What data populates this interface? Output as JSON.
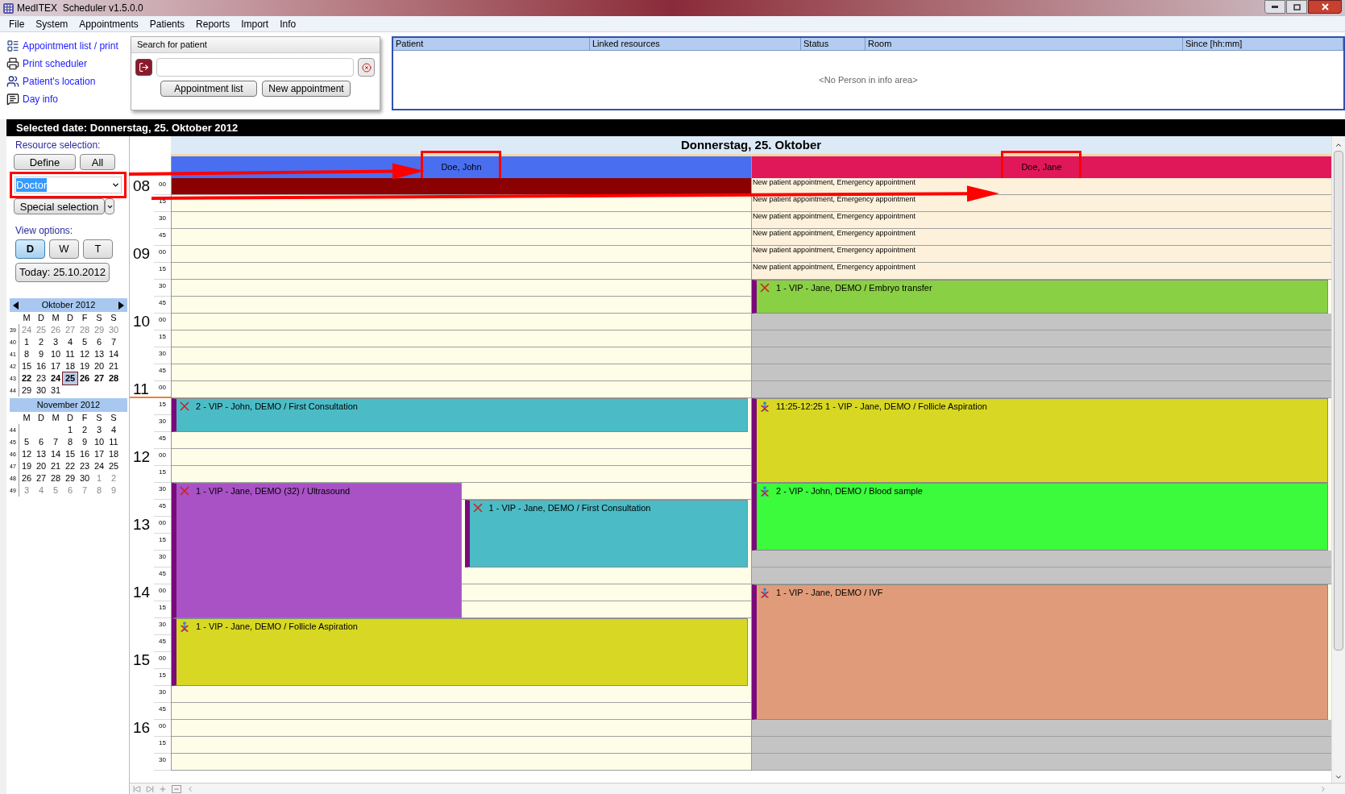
{
  "window": {
    "title": "MedITEX  Scheduler v1.5.0.0"
  },
  "menu": [
    "File",
    "System",
    "Appointments",
    "Patients",
    "Reports",
    "Import",
    "Info"
  ],
  "quick_links": [
    "Appointment list / print",
    "Print scheduler",
    "Patient's location",
    "Day info"
  ],
  "patient_search": {
    "title": "Search for patient",
    "buttons": [
      "Appointment list",
      "New appointment"
    ]
  },
  "info_area": {
    "columns": [
      "Patient",
      "Linked resources",
      "Status",
      "Room",
      "Since [hh:mm]"
    ],
    "empty_text": "<No Person in info area>"
  },
  "selected_date": "Selected date: Donnerstag, 25. Oktober 2012",
  "sidebar": {
    "resource_label": "Resource selection:",
    "resource_buttons": [
      "Define",
      "All"
    ],
    "resource_dropdown": {
      "value": "Doctor",
      "highlighted": true
    },
    "special_selection": "Special selection",
    "view_label": "View options:",
    "views": [
      {
        "label": "D",
        "selected": true
      },
      {
        "label": "W",
        "selected": false
      },
      {
        "label": "T",
        "selected": false
      }
    ],
    "today_button": "Today: 25.10.2012"
  },
  "calendars": [
    {
      "title": "Oktober 2012",
      "arrows": true,
      "weekdays": [
        "M",
        "D",
        "M",
        "D",
        "F",
        "S",
        "S"
      ],
      "weeks": [
        {
          "week": "39",
          "days": [
            {
              "d": "24",
              "outside": true,
              "bold": false,
              "selected": false
            },
            {
              "d": "25",
              "outside": true,
              "bold": false,
              "selected": false
            },
            {
              "d": "26",
              "outside": true,
              "bold": false,
              "selected": false
            },
            {
              "d": "27",
              "outside": true,
              "bold": false,
              "selected": false
            },
            {
              "d": "28",
              "outside": true,
              "bold": false,
              "selected": false
            },
            {
              "d": "29",
              "outside": true,
              "bold": false,
              "selected": false
            },
            {
              "d": "30",
              "outside": true,
              "bold": false,
              "selected": false
            }
          ]
        },
        {
          "week": "40",
          "days": [
            {
              "d": "1",
              "outside": false,
              "bold": false,
              "selected": false
            },
            {
              "d": "2",
              "outside": false,
              "bold": false,
              "selected": false
            },
            {
              "d": "3",
              "outside": false,
              "bold": false,
              "selected": false
            },
            {
              "d": "4",
              "outside": false,
              "bold": false,
              "selected": false
            },
            {
              "d": "5",
              "outside": false,
              "bold": false,
              "selected": false
            },
            {
              "d": "6",
              "outside": false,
              "bold": false,
              "selected": false
            },
            {
              "d": "7",
              "outside": false,
              "bold": false,
              "selected": false
            }
          ]
        },
        {
          "week": "41",
          "days": [
            {
              "d": "8",
              "outside": false,
              "bold": false,
              "selected": false
            },
            {
              "d": "9",
              "outside": false,
              "bold": false,
              "selected": false
            },
            {
              "d": "10",
              "outside": false,
              "bold": false,
              "selected": false
            },
            {
              "d": "11",
              "outside": false,
              "bold": false,
              "selected": false
            },
            {
              "d": "12",
              "outside": false,
              "bold": false,
              "selected": false
            },
            {
              "d": "13",
              "outside": false,
              "bold": false,
              "selected": false
            },
            {
              "d": "14",
              "outside": false,
              "bold": false,
              "selected": false
            }
          ]
        },
        {
          "week": "42",
          "days": [
            {
              "d": "15",
              "outside": false,
              "bold": false,
              "selected": false
            },
            {
              "d": "16",
              "outside": false,
              "bold": false,
              "selected": false
            },
            {
              "d": "17",
              "outside": false,
              "bold": false,
              "selected": false
            },
            {
              "d": "18",
              "outside": false,
              "bold": false,
              "selected": false
            },
            {
              "d": "19",
              "outside": false,
              "bold": false,
              "selected": false
            },
            {
              "d": "20",
              "outside": false,
              "bold": false,
              "selected": false
            },
            {
              "d": "21",
              "outside": false,
              "bold": false,
              "selected": false
            }
          ]
        },
        {
          "week": "43",
          "days": [
            {
              "d": "22",
              "outside": false,
              "bold": true,
              "selected": false
            },
            {
              "d": "23",
              "outside": false,
              "bold": false,
              "selected": false
            },
            {
              "d": "24",
              "outside": false,
              "bold": true,
              "selected": false
            },
            {
              "d": "25",
              "outside": false,
              "bold": true,
              "selected": true
            },
            {
              "d": "26",
              "outside": false,
              "bold": true,
              "selected": false
            },
            {
              "d": "27",
              "outside": false,
              "bold": true,
              "selected": false
            },
            {
              "d": "28",
              "outside": false,
              "bold": true,
              "selected": false
            }
          ]
        },
        {
          "week": "44",
          "days": [
            {
              "d": "29",
              "outside": false,
              "bold": false,
              "selected": false
            },
            {
              "d": "30",
              "outside": false,
              "bold": false,
              "selected": false
            },
            {
              "d": "31",
              "outside": false,
              "bold": false,
              "selected": false
            }
          ]
        }
      ]
    },
    {
      "title": "November 2012",
      "arrows": false,
      "weekdays": [
        "M",
        "D",
        "M",
        "D",
        "F",
        "S",
        "S"
      ],
      "weeks": [
        {
          "week": "44",
          "days": [
            {
              "d": "1",
              "outside": false,
              "bold": false,
              "selected": false
            },
            {
              "d": "2",
              "outside": false,
              "bold": false,
              "selected": false
            },
            {
              "d": "3",
              "outside": false,
              "bold": false,
              "selected": false
            },
            {
              "d": "4",
              "outside": false,
              "bold": false,
              "selected": false
            }
          ]
        },
        {
          "week": "45",
          "days": [
            {
              "d": "5",
              "outside": false,
              "bold": false,
              "selected": false
            },
            {
              "d": "6",
              "outside": false,
              "bold": false,
              "selected": false
            },
            {
              "d": "7",
              "outside": false,
              "bold": false,
              "selected": false
            },
            {
              "d": "8",
              "outside": false,
              "bold": false,
              "selected": false
            },
            {
              "d": "9",
              "outside": false,
              "bold": false,
              "selected": false
            },
            {
              "d": "10",
              "outside": false,
              "bold": false,
              "selected": false
            },
            {
              "d": "11",
              "outside": false,
              "bold": false,
              "selected": false
            }
          ]
        },
        {
          "week": "46",
          "days": [
            {
              "d": "12",
              "outside": false,
              "bold": false,
              "selected": false
            },
            {
              "d": "13",
              "outside": false,
              "bold": false,
              "selected": false
            },
            {
              "d": "14",
              "outside": false,
              "bold": false,
              "selected": false
            },
            {
              "d": "15",
              "outside": false,
              "bold": false,
              "selected": false
            },
            {
              "d": "16",
              "outside": false,
              "bold": false,
              "selected": false
            },
            {
              "d": "17",
              "outside": false,
              "bold": false,
              "selected": false
            },
            {
              "d": "18",
              "outside": false,
              "bold": false,
              "selected": false
            }
          ]
        },
        {
          "week": "47",
          "days": [
            {
              "d": "19",
              "outside": false,
              "bold": false,
              "selected": false
            },
            {
              "d": "20",
              "outside": false,
              "bold": false,
              "selected": false
            },
            {
              "d": "21",
              "outside": false,
              "bold": false,
              "selected": false
            },
            {
              "d": "22",
              "outside": false,
              "bold": false,
              "selected": false
            },
            {
              "d": "23",
              "outside": false,
              "bold": false,
              "selected": false
            },
            {
              "d": "24",
              "outside": false,
              "bold": false,
              "selected": false
            },
            {
              "d": "25",
              "outside": false,
              "bold": false,
              "selected": false
            }
          ]
        },
        {
          "week": "48",
          "days": [
            {
              "d": "26",
              "outside": false,
              "bold": false,
              "selected": false
            },
            {
              "d": "27",
              "outside": false,
              "bold": false,
              "selected": false
            },
            {
              "d": "28",
              "outside": false,
              "bold": false,
              "selected": false
            },
            {
              "d": "29",
              "outside": false,
              "bold": false,
              "selected": false
            },
            {
              "d": "30",
              "outside": false,
              "bold": false,
              "selected": false
            },
            {
              "d": "1",
              "outside": true,
              "bold": false,
              "selected": false
            },
            {
              "d": "2",
              "outside": true,
              "bold": false,
              "selected": false
            }
          ]
        },
        {
          "week": "49",
          "days": [
            {
              "d": "3",
              "outside": true,
              "bold": false,
              "selected": false
            },
            {
              "d": "4",
              "outside": true,
              "bold": false,
              "selected": false
            },
            {
              "d": "5",
              "outside": true,
              "bold": false,
              "selected": false
            },
            {
              "d": "6",
              "outside": true,
              "bold": false,
              "selected": false
            },
            {
              "d": "7",
              "outside": true,
              "bold": false,
              "selected": false
            },
            {
              "d": "8",
              "outside": true,
              "bold": false,
              "selected": false
            },
            {
              "d": "9",
              "outside": true,
              "bold": false,
              "selected": false
            }
          ]
        }
      ]
    }
  ],
  "day": {
    "title": "Donnerstag, 25. Oktober",
    "times": [
      {
        "hour": "08",
        "minute": "00"
      },
      {
        "minute": "15"
      },
      {
        "minute": "30"
      },
      {
        "minute": "45"
      },
      {
        "hour": "09",
        "minute": "00"
      },
      {
        "minute": "15"
      },
      {
        "minute": "30"
      },
      {
        "minute": "45"
      },
      {
        "hour": "10",
        "minute": "00"
      },
      {
        "minute": "15"
      },
      {
        "minute": "30"
      },
      {
        "minute": "45"
      },
      {
        "hour": "11",
        "minute": "00",
        "current": true
      },
      {
        "minute": "15"
      },
      {
        "minute": "30"
      },
      {
        "minute": "45"
      },
      {
        "hour": "12",
        "minute": "00"
      },
      {
        "minute": "15"
      },
      {
        "minute": "30"
      },
      {
        "minute": "45"
      },
      {
        "hour": "13",
        "minute": "00"
      },
      {
        "minute": "15"
      },
      {
        "minute": "30"
      },
      {
        "minute": "45"
      },
      {
        "hour": "14",
        "minute": "00"
      },
      {
        "minute": "15"
      },
      {
        "minute": "30"
      },
      {
        "minute": "45"
      },
      {
        "hour": "15",
        "minute": "00"
      },
      {
        "minute": "15"
      },
      {
        "minute": "30"
      },
      {
        "minute": "45"
      },
      {
        "hour": "16",
        "minute": "00"
      },
      {
        "minute": "15"
      },
      {
        "minute": "30"
      }
    ],
    "resources": [
      {
        "name": "Doe, John",
        "color": "#4a6ef0",
        "highlighted": true,
        "rows": [
          [
            {
              "kind": "blocked",
              "color": "#8b0000"
            }
          ],
          [
            {
              "kind": "free"
            }
          ],
          [
            {
              "kind": "free"
            }
          ],
          [
            {
              "kind": "free"
            }
          ],
          [
            {
              "kind": "free"
            }
          ],
          [
            {
              "kind": "free"
            }
          ],
          [
            {
              "kind": "free"
            }
          ],
          [
            {
              "kind": "free"
            }
          ],
          [
            {
              "kind": "free"
            }
          ],
          [
            {
              "kind": "free"
            }
          ],
          [
            {
              "kind": "free"
            }
          ],
          [
            {
              "kind": "free"
            }
          ],
          [
            {
              "kind": "free"
            }
          ],
          [
            {
              "kind": "appointment",
              "color": "#4bbcc6",
              "patient_icon": false,
              "text": "2 - VIP - John, DEMO / First Consultation"
            }
          ],
          [
            {
              "kind": "continued"
            }
          ],
          [
            {
              "kind": "free"
            }
          ],
          [
            {
              "kind": "free"
            }
          ],
          [
            {
              "kind": "free"
            }
          ],
          [
            {
              "kind": "appointment",
              "color": "#a852c6",
              "patient_icon": false,
              "text": "1 - VIP - Jane, DEMO (32) / Ultrasound"
            },
            {
              "kind": "free"
            }
          ],
          [
            {
              "kind": "continued"
            },
            {
              "kind": "appointment",
              "color": "#4bbcc6",
              "patient_icon": false,
              "text": "1 - VIP - Jane, DEMO / First Consultation"
            }
          ],
          [
            {
              "kind": "continued"
            },
            {
              "kind": "continued"
            }
          ],
          [
            {
              "kind": "continued"
            },
            {
              "kind": "continued"
            }
          ],
          [
            {
              "kind": "continued"
            },
            {
              "kind": "continued"
            }
          ],
          [
            {
              "kind": "continued"
            },
            {
              "kind": "free"
            }
          ],
          [
            {
              "kind": "continued"
            },
            {
              "kind": "free"
            }
          ],
          [
            {
              "kind": "continued"
            },
            {
              "kind": "free"
            }
          ],
          [
            {
              "kind": "appointment",
              "color": "#d8d824",
              "patient_icon": true,
              "text": "1 - VIP - Jane, DEMO / Follicle Aspiration"
            }
          ],
          [
            {
              "kind": "continued"
            }
          ],
          [
            {
              "kind": "continued"
            }
          ],
          [
            {
              "kind": "continued"
            }
          ],
          [
            {
              "kind": "free"
            }
          ],
          [
            {
              "kind": "free"
            }
          ],
          [
            {
              "kind": "free"
            }
          ],
          [
            {
              "kind": "free"
            }
          ],
          [
            {
              "kind": "free"
            }
          ]
        ]
      },
      {
        "name": "Doe, Jane",
        "color": "#e0185a",
        "highlighted": true,
        "rows": [
          [
            {
              "kind": "label",
              "text": "New patient appointment, Emergency appointment"
            }
          ],
          [
            {
              "kind": "label",
              "text": "New patient appointment, Emergency appointment"
            }
          ],
          [
            {
              "kind": "label",
              "text": "New patient appointment, Emergency appointment"
            }
          ],
          [
            {
              "kind": "label",
              "text": "New patient appointment, Emergency appointment"
            }
          ],
          [
            {
              "kind": "label",
              "text": "New patient appointment, Emergency appointment"
            }
          ],
          [
            {
              "kind": "label",
              "text": "New patient appointment, Emergency appointment"
            }
          ],
          [
            {
              "kind": "appointment",
              "color": "#8ad044",
              "patient_icon": false,
              "text": "1 - VIP - Jane, DEMO / Embryo transfer"
            }
          ],
          [
            {
              "kind": "continued"
            }
          ],
          [
            {
              "kind": "unavailable"
            }
          ],
          [
            {
              "kind": "unavailable"
            }
          ],
          [
            {
              "kind": "unavailable"
            }
          ],
          [
            {
              "kind": "unavailable"
            }
          ],
          [
            {
              "kind": "unavailable"
            }
          ],
          [
            {
              "kind": "appointment",
              "color": "#d8d824",
              "patient_icon": true,
              "text": "11:25-12:25 1 - VIP - Jane, DEMO / Follicle Aspiration"
            }
          ],
          [
            {
              "kind": "continued"
            }
          ],
          [
            {
              "kind": "continued"
            }
          ],
          [
            {
              "kind": "continued"
            }
          ],
          [
            {
              "kind": "continued"
            }
          ],
          [
            {
              "kind": "appointment",
              "color": "#3cfa3c",
              "patient_icon": true,
              "text": "2 - VIP - John, DEMO / Blood sample"
            }
          ],
          [
            {
              "kind": "continued"
            }
          ],
          [
            {
              "kind": "continued"
            }
          ],
          [
            {
              "kind": "continued"
            }
          ],
          [
            {
              "kind": "unavailable"
            }
          ],
          [
            {
              "kind": "unavailable"
            }
          ],
          [
            {
              "kind": "appointment",
              "color": "#e09c7a",
              "patient_icon": true,
              "text": "1 - VIP - Jane, DEMO / IVF"
            }
          ],
          [
            {
              "kind": "continued"
            }
          ],
          [
            {
              "kind": "continued"
            }
          ],
          [
            {
              "kind": "continued"
            }
          ],
          [
            {
              "kind": "continued"
            }
          ],
          [
            {
              "kind": "continued"
            }
          ],
          [
            {
              "kind": "continued"
            }
          ],
          [
            {
              "kind": "continued"
            }
          ],
          [
            {
              "kind": "unavailable"
            }
          ],
          [
            {
              "kind": "unavailable"
            }
          ],
          [
            {
              "kind": "unavailable"
            }
          ]
        ]
      }
    ]
  }
}
